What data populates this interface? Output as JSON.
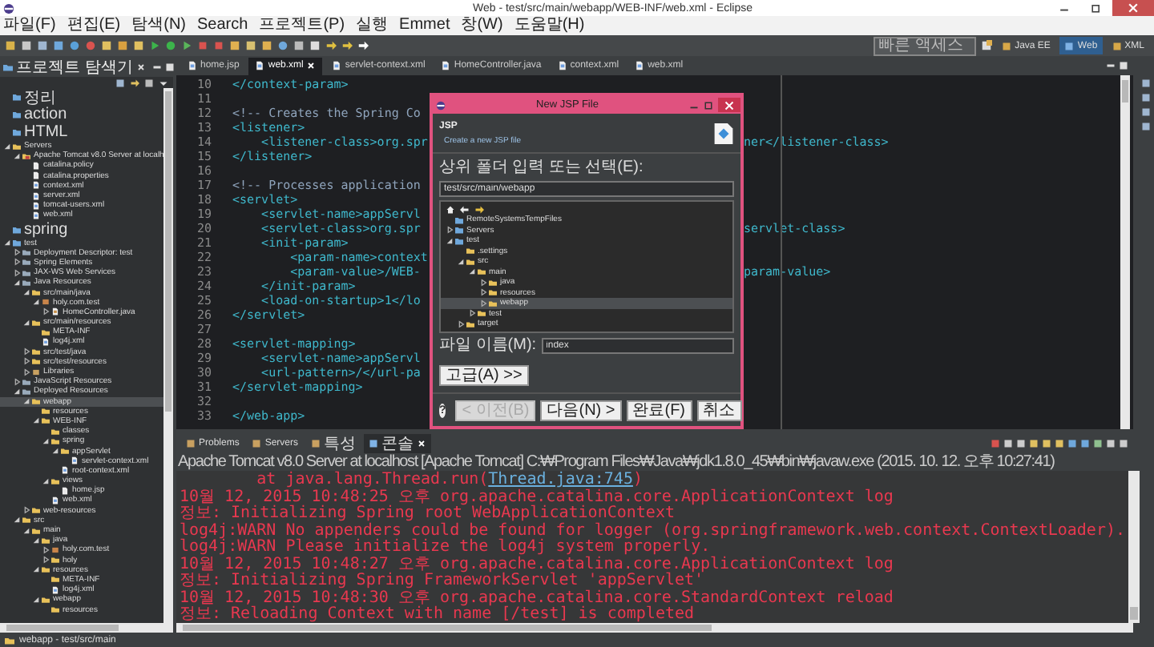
{
  "window": {
    "title": "Web - test/src/main/webapp/WEB-INF/web.xml - Eclipse"
  },
  "menu": [
    "파일(F)",
    "편집(E)",
    "탐색(N)",
    "Search",
    "프로젝트(P)",
    "실행",
    "Emmet",
    "창(W)",
    "도움말(H)"
  ],
  "quick_access": {
    "placeholder": "빠른 액세스"
  },
  "perspectives": [
    {
      "label": "Java EE",
      "selected": false
    },
    {
      "label": "Web",
      "selected": true
    },
    {
      "label": "XML",
      "selected": false
    }
  ],
  "explorer": {
    "title": "프로젝트 탐색기",
    "items": [
      {
        "label": "정리",
        "kind": "closed",
        "selected": false
      },
      {
        "label": "action",
        "kind": "closed",
        "selected": false
      },
      {
        "label": "HTML",
        "kind": "closed",
        "selected": false
      },
      {
        "label": "Servers",
        "kind": "folder",
        "expanded": true,
        "selected": false,
        "children": [
          {
            "label": "Apache Tomcat v8.0 Server at localh",
            "kind": "server",
            "expanded": true,
            "selected": false,
            "children": [
              {
                "label": "catalina.policy",
                "kind": "file",
                "selected": false
              },
              {
                "label": "catalina.properties",
                "kind": "file",
                "selected": false
              },
              {
                "label": "context.xml",
                "kind": "xml",
                "selected": false
              },
              {
                "label": "server.xml",
                "kind": "xml",
                "selected": false
              },
              {
                "label": "tomcat-users.xml",
                "kind": "xml",
                "selected": false
              },
              {
                "label": "web.xml",
                "kind": "xml",
                "selected": false
              }
            ]
          }
        ]
      },
      {
        "label": "spring",
        "kind": "closed",
        "selected": false
      },
      {
        "label": "test",
        "kind": "project",
        "expanded": true,
        "selected": false,
        "children": [
          {
            "label": "Deployment Descriptor: test",
            "kind": "node",
            "expanded": false,
            "selected": false
          },
          {
            "label": "Spring Elements",
            "kind": "node",
            "expanded": false,
            "selected": false
          },
          {
            "label": "JAX-WS Web Services",
            "kind": "node",
            "expanded": false,
            "selected": false
          },
          {
            "label": "Java Resources",
            "kind": "node",
            "expanded": true,
            "selected": false,
            "children": [
              {
                "label": "src/main/java",
                "kind": "folder",
                "expanded": true,
                "selected": false,
                "children": [
                  {
                    "label": "holy.com.test",
                    "kind": "package",
                    "expanded": true,
                    "selected": false,
                    "children": [
                      {
                        "label": "HomeController.java",
                        "kind": "java",
                        "expanded": false,
                        "selected": false
                      }
                    ]
                  }
                ]
              },
              {
                "label": "src/main/resources",
                "kind": "folder",
                "expanded": true,
                "selected": false,
                "children": [
                  {
                    "label": "META-INF",
                    "kind": "folder",
                    "selected": false
                  },
                  {
                    "label": "log4j.xml",
                    "kind": "xml",
                    "selected": false
                  }
                ]
              },
              {
                "label": "src/test/java",
                "kind": "folder",
                "expanded": false,
                "selected": false
              },
              {
                "label": "src/test/resources",
                "kind": "folder",
                "expanded": false,
                "selected": false
              },
              {
                "label": "Libraries",
                "kind": "lib",
                "expanded": false,
                "selected": false
              }
            ]
          },
          {
            "label": "JavaScript Resources",
            "kind": "node",
            "expanded": false,
            "selected": false
          },
          {
            "label": "Deployed Resources",
            "kind": "node",
            "expanded": true,
            "selected": false,
            "children": [
              {
                "label": "webapp",
                "kind": "folder",
                "expanded": true,
                "selected": true,
                "children": [
                  {
                    "label": "resources",
                    "kind": "folder",
                    "selected": false
                  },
                  {
                    "label": "WEB-INF",
                    "kind": "folder",
                    "expanded": true,
                    "selected": false,
                    "children": [
                      {
                        "label": "classes",
                        "kind": "folder",
                        "selected": false
                      },
                      {
                        "label": "spring",
                        "kind": "folder",
                        "expanded": true,
                        "selected": false,
                        "children": [
                          {
                            "label": "appServlet",
                            "kind": "folder",
                            "expanded": true,
                            "selected": false,
                            "children": [
                              {
                                "label": "servlet-context.xml",
                                "kind": "xml",
                                "selected": false
                              }
                            ]
                          },
                          {
                            "label": "root-context.xml",
                            "kind": "xml",
                            "selected": false
                          }
                        ]
                      },
                      {
                        "label": "views",
                        "kind": "folder",
                        "expanded": true,
                        "selected": false,
                        "children": [
                          {
                            "label": "home.jsp",
                            "kind": "file",
                            "selected": false
                          }
                        ]
                      },
                      {
                        "label": "web.xml",
                        "kind": "xml",
                        "selected": false
                      }
                    ]
                  }
                ]
              },
              {
                "label": "web-resources",
                "kind": "folder",
                "expanded": false,
                "selected": false
              }
            ]
          },
          {
            "label": "src",
            "kind": "folder",
            "expanded": true,
            "selected": false,
            "children": [
              {
                "label": "main",
                "kind": "folder",
                "expanded": true,
                "selected": false,
                "children": [
                  {
                    "label": "java",
                    "kind": "folder",
                    "expanded": true,
                    "selected": false,
                    "children": [
                      {
                        "label": "holy.com.test",
                        "kind": "package",
                        "expanded": false,
                        "selected": false
                      },
                      {
                        "label": "holy",
                        "kind": "folder",
                        "expanded": false,
                        "selected": false
                      }
                    ]
                  },
                  {
                    "label": "resources",
                    "kind": "folder",
                    "expanded": true,
                    "selected": false,
                    "children": [
                      {
                        "label": "META-INF",
                        "kind": "folder",
                        "selected": false
                      },
                      {
                        "label": "log4j.xml",
                        "kind": "xml",
                        "selected": false
                      }
                    ]
                  },
                  {
                    "label": "webapp",
                    "kind": "folder",
                    "expanded": true,
                    "selected": false,
                    "children": [
                      {
                        "label": "resources",
                        "kind": "folder",
                        "selected": false
                      }
                    ]
                  }
                ]
              }
            ]
          }
        ]
      }
    ]
  },
  "editor": {
    "tabs": [
      {
        "label": "home.jsp",
        "selected": false
      },
      {
        "label": "web.xml",
        "selected": true
      },
      {
        "label": "servlet-context.xml",
        "selected": false
      },
      {
        "label": "HomeController.java",
        "selected": false
      },
      {
        "label": "context.xml",
        "selected": false
      },
      {
        "label": "web.xml",
        "selected": false
      }
    ],
    "lines": [
      {
        "number": "10",
        "kind": "tag",
        "text": "</context-param>"
      },
      {
        "number": "11"
      },
      {
        "number": "12",
        "kind": "comment",
        "text": "<!-- Creates the Spring Co"
      },
      {
        "number": "13",
        "kind": "tag",
        "text": "<listener>"
      },
      {
        "number": "14",
        "kind": "tag",
        "text": "    <listener-class>org.spr",
        "right": "ner</listener-class>"
      },
      {
        "number": "15",
        "kind": "tag",
        "text": "</listener>"
      },
      {
        "number": "16"
      },
      {
        "number": "17",
        "kind": "comment",
        "text": "<!-- Processes application"
      },
      {
        "number": "18",
        "kind": "tag",
        "text": "<servlet>"
      },
      {
        "number": "19",
        "kind": "tag",
        "text": "    <servlet-name>appServl"
      },
      {
        "number": "20",
        "kind": "tag",
        "text": "    <servlet-class>org.spr",
        "right": "servlet-class>"
      },
      {
        "number": "21",
        "kind": "tag",
        "text": "    <init-param>"
      },
      {
        "number": "22",
        "kind": "tag",
        "text": "        <param-name>context"
      },
      {
        "number": "23",
        "kind": "tag",
        "text": "        <param-value>/WEB-",
        "right": "param-value>"
      },
      {
        "number": "24",
        "kind": "tag",
        "text": "    </init-param>"
      },
      {
        "number": "25",
        "kind": "tag",
        "text": "    <load-on-startup>1</lo"
      },
      {
        "number": "26",
        "kind": "tag",
        "text": "</servlet>"
      },
      {
        "number": "27"
      },
      {
        "number": "28",
        "kind": "tag",
        "text": "<servlet-mapping>"
      },
      {
        "number": "29",
        "kind": "tag",
        "text": "    <servlet-name>appServl"
      },
      {
        "number": "30",
        "kind": "tag",
        "text": "    <url-pattern>/</url-pa"
      },
      {
        "number": "31",
        "kind": "tag",
        "text": "</servlet-mapping>"
      },
      {
        "number": "32"
      },
      {
        "number": "33",
        "kind": "tag",
        "text": "</web-app>"
      }
    ]
  },
  "dialog": {
    "title": "New JSP File",
    "heading": "JSP",
    "description": "Create a new JSP file",
    "folder_label": "상위 폴더 입력 또는 선택(E):",
    "folder_value": "test/src/main/webapp",
    "tree": [
      {
        "label": "RemoteSystemsTempFiles",
        "kind": "project",
        "selected": false
      },
      {
        "label": "Servers",
        "kind": "project",
        "expanded": false,
        "selected": false
      },
      {
        "label": "test",
        "kind": "project",
        "expanded": true,
        "selected": false,
        "children": [
          {
            "label": ".settings",
            "kind": "folder",
            "selected": false
          },
          {
            "label": "src",
            "kind": "folder",
            "expanded": true,
            "selected": false,
            "children": [
              {
                "label": "main",
                "kind": "folder",
                "expanded": true,
                "selected": false,
                "children": [
                  {
                    "label": "java",
                    "kind": "folder",
                    "expanded": false,
                    "selected": false
                  },
                  {
                    "label": "resources",
                    "kind": "folder",
                    "expanded": false,
                    "selected": false
                  },
                  {
                    "label": "webapp",
                    "kind": "folder",
                    "expanded": false,
                    "selected": true
                  }
                ]
              },
              {
                "label": "test",
                "kind": "folder",
                "expanded": false,
                "selected": false
              }
            ]
          },
          {
            "label": "target",
            "kind": "folder",
            "expanded": false,
            "selected": false
          }
        ]
      }
    ],
    "name_label": "파일 이름(M):",
    "name_value": "index",
    "advanced": "고급(A) >>",
    "help": "?",
    "buttons": [
      {
        "label": "< 이전(B)",
        "disabled": true
      },
      {
        "label": "다음(N) >",
        "disabled": false
      },
      {
        "label": "완료(F)",
        "disabled": false
      },
      {
        "label": "취소",
        "disabled": false
      }
    ]
  },
  "console": {
    "tabs": [
      {
        "label": "Problems",
        "selected": false
      },
      {
        "label": "Servers",
        "selected": false
      },
      {
        "label": "특성",
        "selected": false
      },
      {
        "label": "콘솔",
        "selected": true
      }
    ],
    "header": "Apache Tomcat v8.0 Server at localhost [Apache Tomcat] C:₩Program Files₩Java₩jdk1.8.0_45₩bin₩javaw.exe (2015. 10. 12. 오후 10:27:41)",
    "lines": [
      {
        "kind": "trace",
        "text": "        at java.lang.Thread.run(",
        "link": "Thread.java:745",
        "after": ")"
      },
      {
        "kind": "log",
        "text": "10월 12, 2015 10:48:25 오후 org.apache.catalina.core.ApplicationContext log"
      },
      {
        "kind": "log",
        "text": "정보: Initializing Spring root WebApplicationContext"
      },
      {
        "kind": "log",
        "text": "log4j:WARN No appenders could be found for logger (org.springframework.web.context.ContextLoader)."
      },
      {
        "kind": "log",
        "text": "log4j:WARN Please initialize the log4j system properly."
      },
      {
        "kind": "log",
        "text": "10월 12, 2015 10:48:27 오후 org.apache.catalina.core.ApplicationContext log"
      },
      {
        "kind": "log",
        "text": "정보: Initializing Spring FrameworkServlet 'appServlet'"
      },
      {
        "kind": "log",
        "text": "10월 12, 2015 10:48:30 오후 org.apache.catalina.core.StandardContext reload"
      },
      {
        "kind": "log",
        "text": "정보: Reloading Context with name [/test] is completed"
      }
    ]
  },
  "status_bar": "webapp - test/src/main"
}
